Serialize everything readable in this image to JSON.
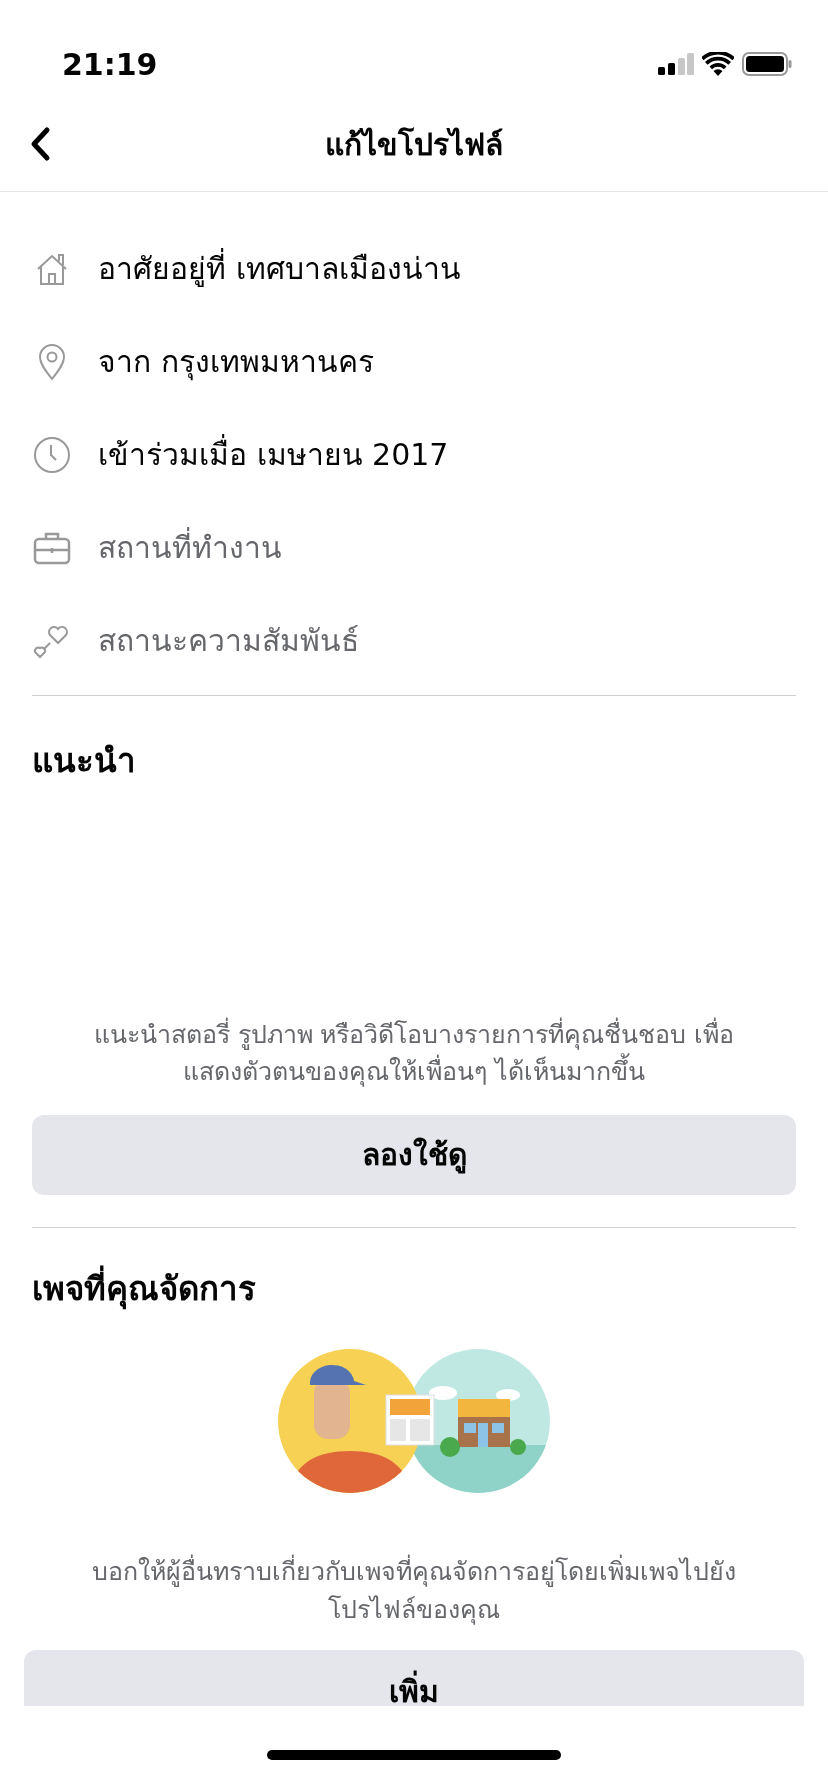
{
  "status_bar": {
    "time": "21:19"
  },
  "nav": {
    "title": "แก้ไขโปรไฟล์"
  },
  "details": [
    {
      "kind": "house",
      "text": "อาศัยอยู่ที่ เทศบาลเมืองน่าน",
      "empty": false
    },
    {
      "kind": "pin",
      "text": "จาก กรุงเทพมหานคร",
      "empty": false
    },
    {
      "kind": "clock",
      "text": "เข้าร่วมเมื่อ เมษายน  2017",
      "empty": false
    },
    {
      "kind": "briefcase",
      "text": "สถานที่ทำงาน",
      "empty": true
    },
    {
      "kind": "hearts",
      "text": "สถานะความสัมพันธ์",
      "empty": true
    }
  ],
  "featured": {
    "heading": "แนะนำ",
    "description": "แนะนำสตอรี่ รูปภาพ หรือวิดีโอบางรายการที่คุณชื่นชอบ เพื่อแสดงตัวตนของคุณให้เพื่อนๆ ได้เห็นมากขึ้น",
    "button": "ลองใช้ดู"
  },
  "pages": {
    "heading": "เพจที่คุณจัดการ",
    "description": "บอกให้ผู้อื่นทราบเกี่ยวกับเพจที่คุณจัดการอยู่โดยเพิ่มเพจไปยังโปรไฟล์ของคุณ",
    "button": "เพิ่ม"
  }
}
